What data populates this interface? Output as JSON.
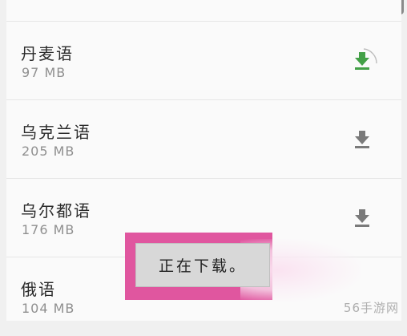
{
  "languages": [
    {
      "name": "丹麦语",
      "size": "97 MB",
      "downloading": true
    },
    {
      "name": "乌克兰语",
      "size": "205 MB",
      "downloading": false
    },
    {
      "name": "乌尔都语",
      "size": "176 MB",
      "downloading": false
    },
    {
      "name": "俄语",
      "size": "104 MB",
      "downloading": false
    }
  ],
  "toast": {
    "text": "正在下载。"
  },
  "watermark": "56手游网",
  "colors": {
    "active_download": "#43a047",
    "inactive_download": "#7a7a7a",
    "highlight": "#e0569f"
  },
  "icons": {
    "download": "download-icon",
    "progress": "progress-ring-icon"
  }
}
